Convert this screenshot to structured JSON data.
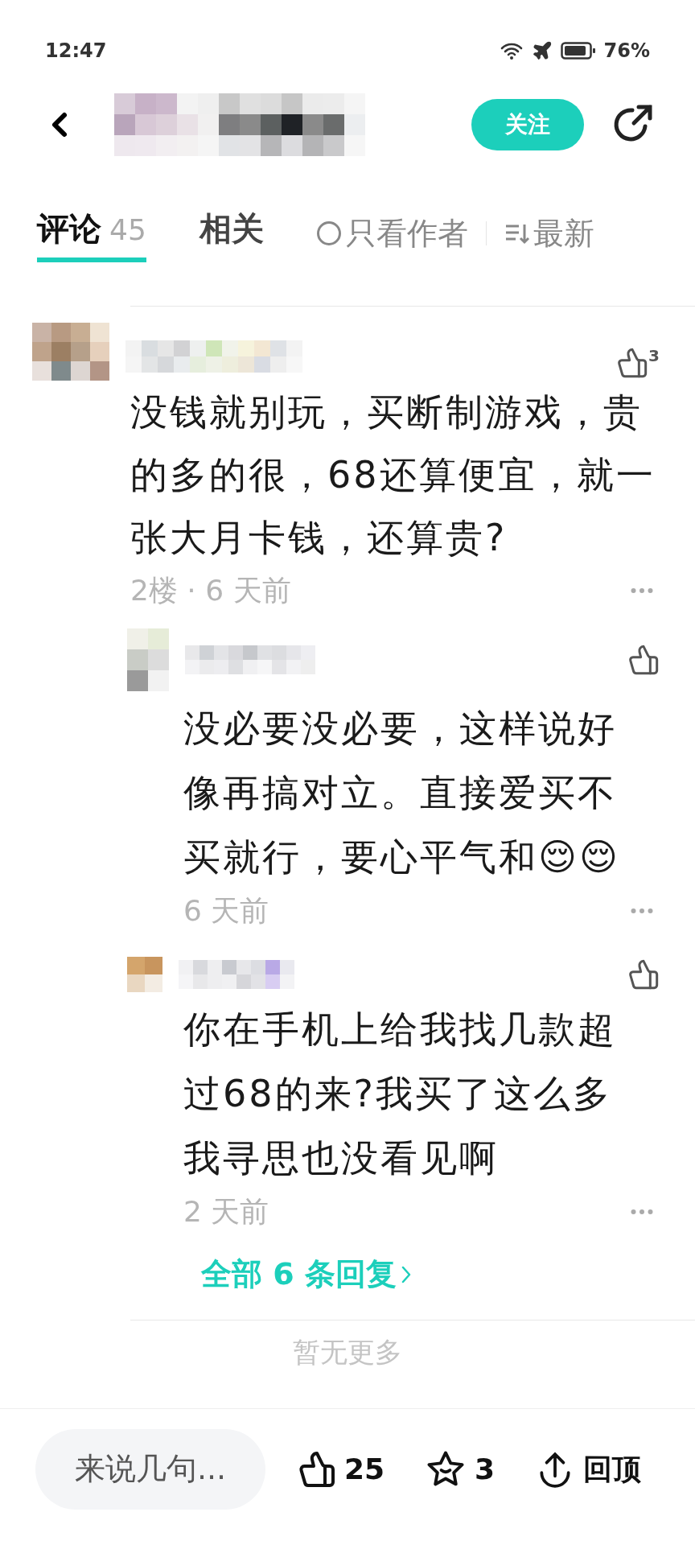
{
  "status_bar": {
    "time": "12:47",
    "battery": "76%"
  },
  "header": {
    "follow_button": "关注"
  },
  "tabs": [
    {
      "label": "评论",
      "count": "45",
      "selected": true
    },
    {
      "label": "相关",
      "selected": false
    }
  ],
  "filters": {
    "author_only": {
      "label": "只看作者",
      "checked": false
    },
    "sort": "最新"
  },
  "comment": {
    "likes": "3",
    "text": "没钱就别玩，买断制游戏，贵的多的很，68还算便宜，就一张大月卡钱，还算贵?",
    "floor": "2楼",
    "separator": "·",
    "time": "6 天前",
    "replies": [
      {
        "text": "没必要没必要，这样说好像再搞对立。直接爱买不买就行，要心平气和😌😌",
        "time": "6 天前"
      },
      {
        "text": "你在手机上给我找几款超过68的来?我买了这么多我寻思也没看见啊",
        "time": "2 天前"
      }
    ],
    "all_replies": "全部 6 条回复"
  },
  "end_note": "暂无更多",
  "bottom_bar": {
    "input_placeholder": "来说几句...",
    "likes": "25",
    "favorites": "3",
    "top_button": "回顶"
  }
}
